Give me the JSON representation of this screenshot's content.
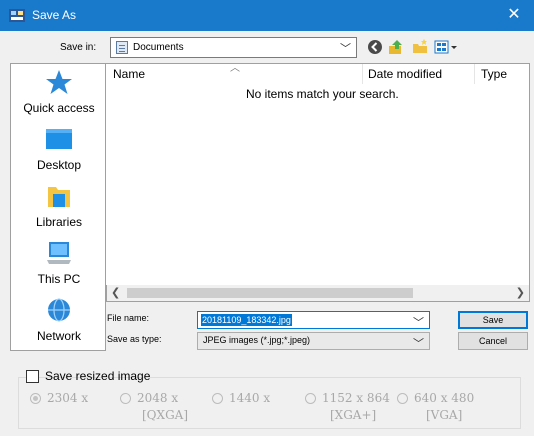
{
  "window": {
    "title": "Save As",
    "close_symbol": "✕"
  },
  "toolbar": {
    "save_in_label": "Save in:",
    "save_in_value": "Documents",
    "icons": [
      "back-icon",
      "up-folder-icon",
      "new-folder-icon",
      "views-menu-icon"
    ]
  },
  "places": [
    {
      "label": "Quick access",
      "icon": "quick-access-icon"
    },
    {
      "label": "Desktop",
      "icon": "desktop-icon"
    },
    {
      "label": "Libraries",
      "icon": "libraries-icon"
    },
    {
      "label": "This PC",
      "icon": "this-pc-icon"
    },
    {
      "label": "Network",
      "icon": "network-icon"
    }
  ],
  "file_list": {
    "columns": [
      "Name",
      "Date modified",
      "Type"
    ],
    "empty_message": "No items match your search."
  },
  "form": {
    "file_name_label": "File name:",
    "file_name_value": "20181109_183342.jpg",
    "save_as_type_label": "Save as type:",
    "save_as_type_value": "JPEG images (*.jpg;*.jpeg)",
    "save_button": "Save",
    "cancel_button": "Cancel"
  },
  "resize": {
    "checkbox_label": "Save resized image",
    "checked": false,
    "options": [
      {
        "line1": "2304 x",
        "line2": "",
        "selected": true
      },
      {
        "line1": "2048 x",
        "line2": "[QXGA]",
        "selected": false
      },
      {
        "line1": "1440 x",
        "line2": "",
        "selected": false
      },
      {
        "line1": "1152 x 864",
        "line2": "[XGA+]",
        "selected": false
      },
      {
        "line1": "640 x 480",
        "line2": "[VGA]",
        "selected": false
      }
    ]
  },
  "colors": {
    "titlebar": "#1979ca",
    "selection": "#0078d7",
    "disabled_text": "#a8a8a8"
  }
}
